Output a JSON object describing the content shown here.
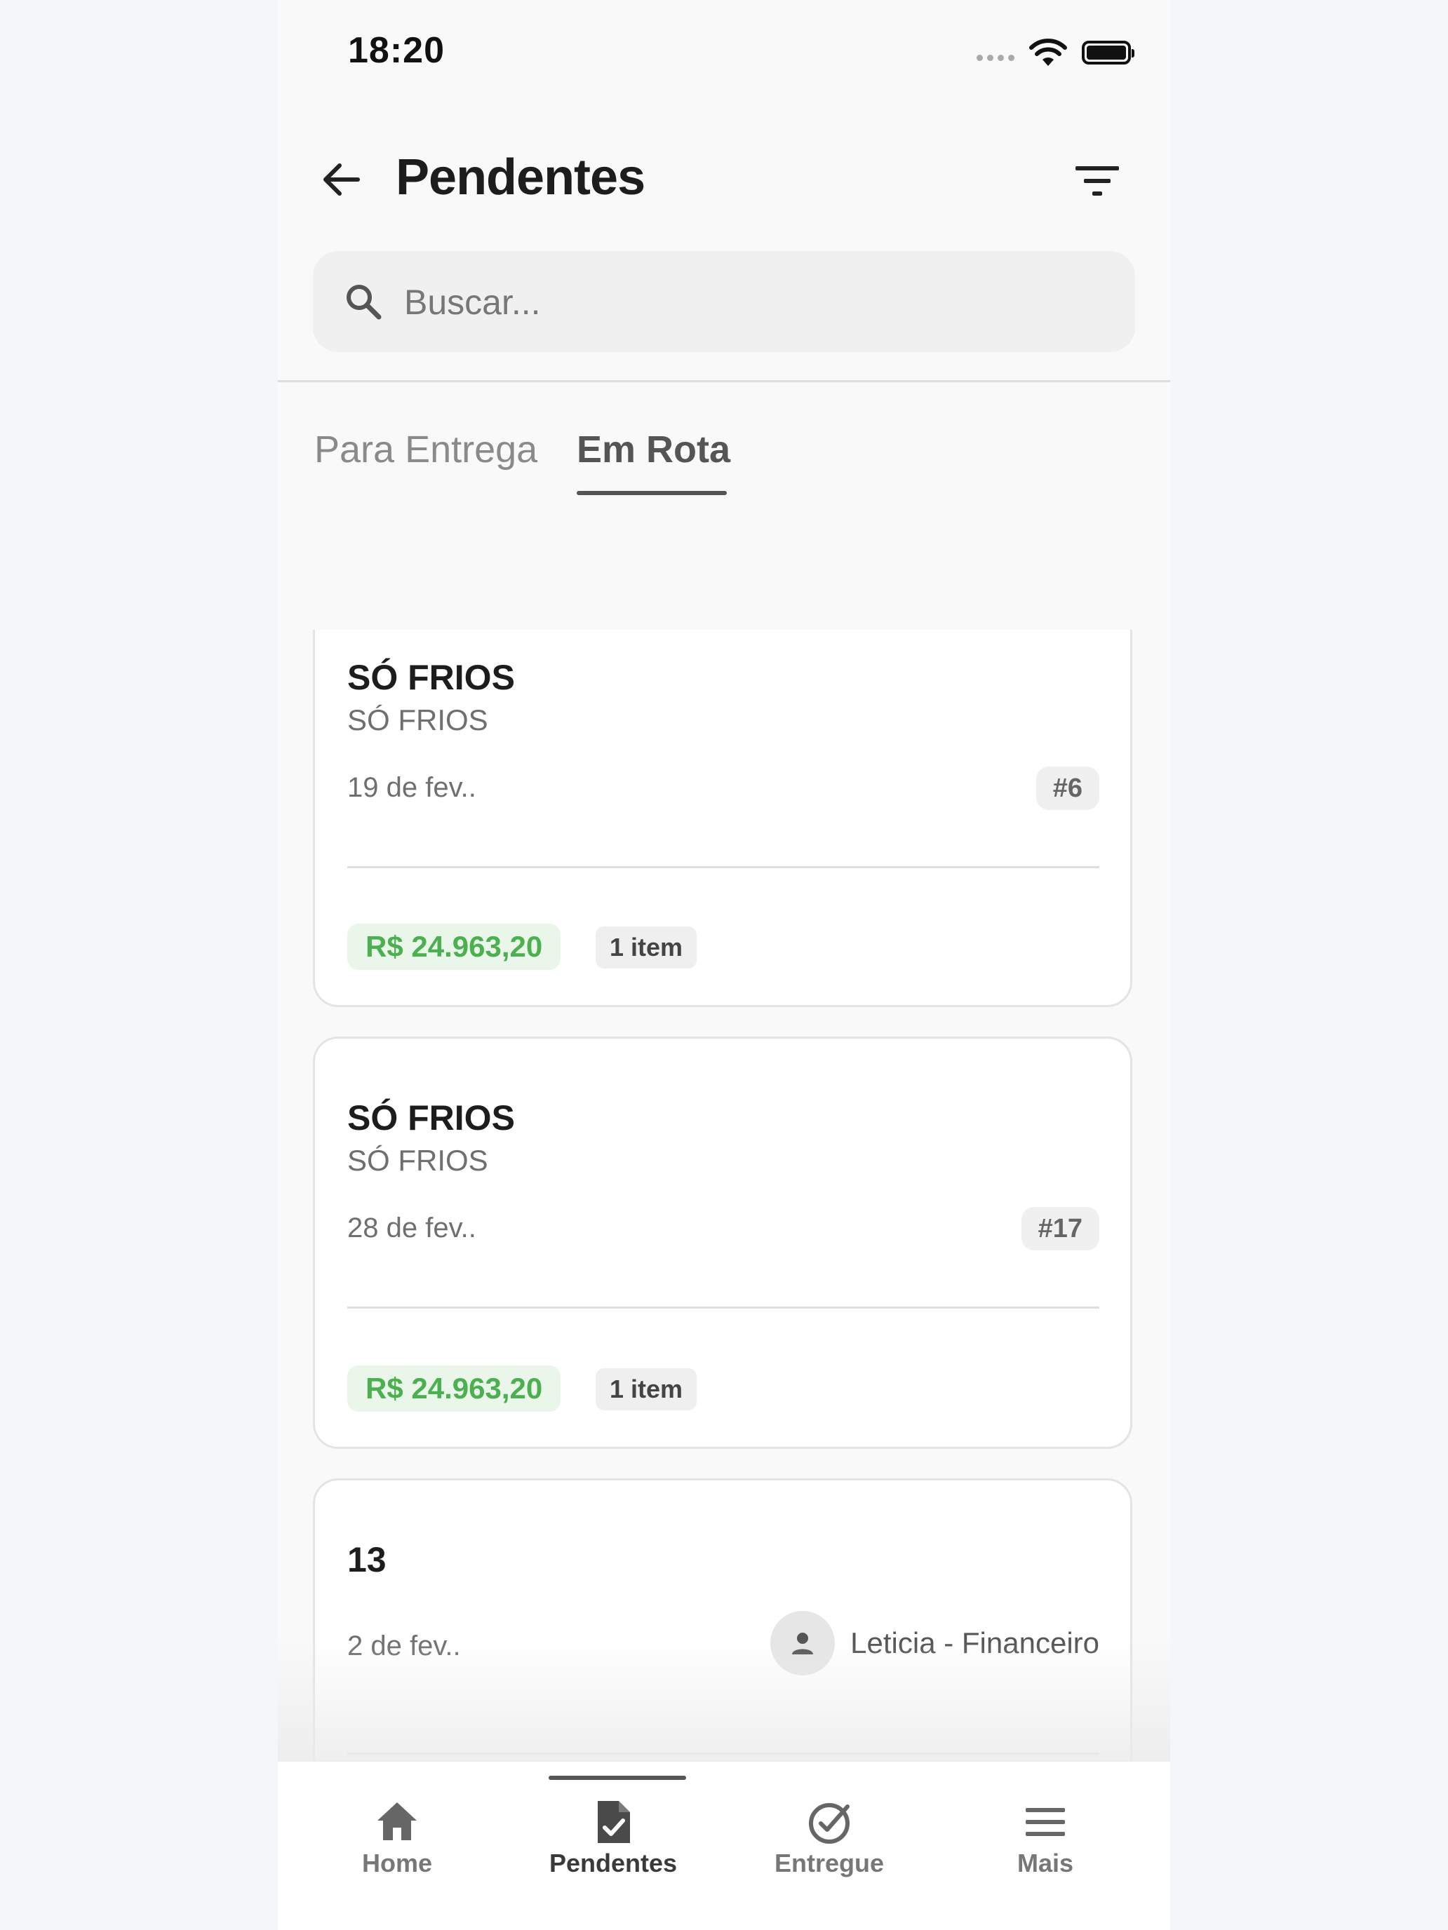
{
  "status_bar": {
    "time": "18:20"
  },
  "header": {
    "title": "Pendentes"
  },
  "search": {
    "placeholder": "Buscar..."
  },
  "tabs": [
    {
      "label": "Para Entrega",
      "active": false
    },
    {
      "label": "Em Rota",
      "active": true
    }
  ],
  "orders": [
    {
      "title": "SÓ FRIOS",
      "subtitle": "SÓ FRIOS",
      "date": "19 de fev..",
      "number": "#6",
      "price": "R$ 24.963,20",
      "items": "1 item"
    },
    {
      "title": "SÓ FRIOS",
      "subtitle": "SÓ FRIOS",
      "date": "28 de fev..",
      "number": "#17",
      "price": "R$ 24.963,20",
      "items": "1 item"
    },
    {
      "title": "13",
      "date": "2 de fev..",
      "assignee": "Leticia - Financeiro"
    }
  ],
  "bottom_nav": [
    {
      "label": "Home",
      "icon": "home-icon",
      "active": false
    },
    {
      "label": "Pendentes",
      "icon": "document-check-icon",
      "active": true
    },
    {
      "label": "Entregue",
      "icon": "check-circle-icon",
      "active": false
    },
    {
      "label": "Mais",
      "icon": "menu-icon",
      "active": false
    }
  ],
  "colors": {
    "price_green": "#4caf50",
    "price_bg": "#eaf6ea",
    "accent_dark": "#555555"
  }
}
